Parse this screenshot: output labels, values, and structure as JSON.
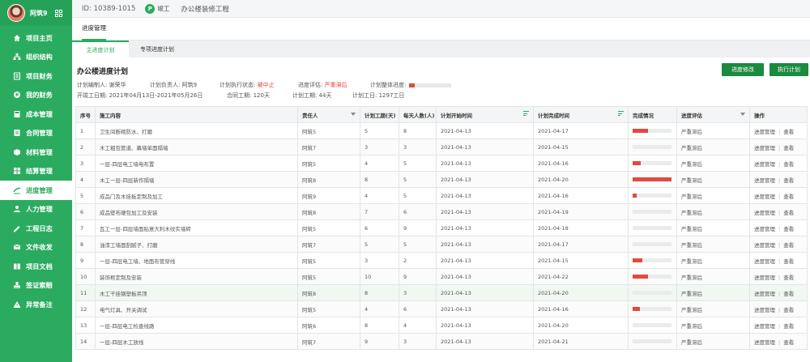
{
  "sidebar": {
    "user": "阿筑9",
    "items": [
      {
        "label": "项目主页",
        "icon": "home-icon"
      },
      {
        "label": "组织结构",
        "icon": "org-icon"
      },
      {
        "label": "项目财务",
        "icon": "finance-icon"
      },
      {
        "label": "我的财务",
        "icon": "wallet-icon"
      },
      {
        "label": "成本管理",
        "icon": "calc-icon"
      },
      {
        "label": "合同管理",
        "icon": "contract-icon"
      },
      {
        "label": "材料管理",
        "icon": "material-icon"
      },
      {
        "label": "结算管理",
        "icon": "grid-icon"
      },
      {
        "label": "进度管理",
        "icon": "progress-icon",
        "active": true
      },
      {
        "label": "人力管理",
        "icon": "person-icon"
      },
      {
        "label": "工程日志",
        "icon": "log-icon"
      },
      {
        "label": "文件收发",
        "icon": "mail-icon"
      },
      {
        "label": "项目文档",
        "icon": "book-icon"
      },
      {
        "label": "签证索赔",
        "icon": "stamp-icon"
      },
      {
        "label": "异常备注",
        "icon": "warning-icon"
      }
    ]
  },
  "header": {
    "id_text": "ID: 10389-1015",
    "badge": "P",
    "status": "竣工",
    "project": "办公楼装修工程"
  },
  "subnav": {
    "active": "进度管理"
  },
  "tabs": [
    "主进度计划",
    "专项进度计划"
  ],
  "panel": {
    "title": "办公楼进度计划",
    "btn_edit": "进度修改",
    "btn_run": "执行计划",
    "info1": {
      "maker": "计划编制人: 谢荣华",
      "owner": "计划负责人: 阿筑9",
      "exec_label": "计划执行状态: ",
      "exec_value": "被中止",
      "eval_label": "进度评估: ",
      "eval_value": "严重滞后",
      "overall_label": "计划整体进度:",
      "overall_progress": 0.12
    },
    "info2": {
      "dates": "开竣工日期: 2021年04月13日-2021年05月26日",
      "contract": "合同工期: 120天",
      "plan": "计划工期: 44天",
      "workdays": "计划工日: 1297工日"
    }
  },
  "table": {
    "headers": [
      "序号",
      "施工内容",
      "责任人",
      "计划工期(天)",
      "每天人数(人)",
      "计划开始时间",
      "计划完成时间",
      "完成情况",
      "进度评估",
      "操作"
    ],
    "op_manage": "进度管理",
    "op_sep": "|",
    "op_view": "查看",
    "rows": [
      {
        "no": "1",
        "content": "卫生间断砌防水、打磨",
        "person": "阿筑5",
        "days": "5",
        "people": "8",
        "start": "2021-04-13",
        "end": "2021-04-17",
        "progress": 0.4,
        "eval": "严重滞后"
      },
      {
        "no": "2",
        "content": "木工粗包管道、幕墙单面隔墙",
        "person": "阿筑7",
        "days": "3",
        "people": "3",
        "start": "2021-04-13",
        "end": "2021-04-15",
        "progress": 0,
        "eval": "严重滞后"
      },
      {
        "no": "3",
        "content": "一层-四层电工墙电布置",
        "person": "阿筑5",
        "days": "4",
        "people": "5",
        "start": "2021-04-13",
        "end": "2021-04-16",
        "progress": 0.2,
        "eval": "严重滞后"
      },
      {
        "no": "4",
        "content": "木工一层-四层新作隔墙",
        "person": "阿筑8",
        "days": "8",
        "people": "5",
        "start": "2021-04-13",
        "end": "2021-04-20",
        "progress": 1.0,
        "eval": "严重滞后"
      },
      {
        "no": "5",
        "content": "成品门及木挂板定制及加工",
        "person": "阿筑9",
        "days": "4",
        "people": "5",
        "start": "2021-04-13",
        "end": "2021-04-16",
        "progress": 0.1,
        "eval": "严重滞后"
      },
      {
        "no": "6",
        "content": "成品壁布硬包加工及安装",
        "person": "阿筑8",
        "days": "7",
        "people": "6",
        "start": "2021-04-13",
        "end": "2021-04-19",
        "progress": 0,
        "eval": "严重滞后"
      },
      {
        "no": "7",
        "content": "瓦工一层-四层墙面贴意大利木纹实墙砖",
        "person": "阿筑5",
        "days": "6",
        "people": "9",
        "start": "2021-04-13",
        "end": "2021-04-18",
        "progress": 0,
        "eval": "严重滞后"
      },
      {
        "no": "8",
        "content": "油漆工墙面刮腻子、打磨",
        "person": "阿筑7",
        "days": "5",
        "people": "5",
        "start": "2021-04-13",
        "end": "2021-04-17",
        "progress": 0,
        "eval": "严重滞后"
      },
      {
        "no": "9",
        "content": "一层-四层电工墙、地面布管穿线",
        "person": "阿筑5",
        "days": "3",
        "people": "2",
        "start": "2021-04-13",
        "end": "2021-04-15",
        "progress": 0.25,
        "eval": "严重滞后"
      },
      {
        "no": "10",
        "content": "装饰柜定制及安装",
        "person": "阿筑5",
        "days": "10",
        "people": "9",
        "start": "2021-04-13",
        "end": "2021-04-22",
        "progress": 0.4,
        "eval": "严重滞后"
      },
      {
        "no": "11",
        "content": "木工干挂钢塑板吊顶",
        "person": "阿筑8",
        "days": "8",
        "people": "3",
        "start": "2021-04-13",
        "end": "2021-04-20",
        "progress": 0,
        "eval": "严重滞后"
      },
      {
        "no": "12",
        "content": "电气灯具、开关调试",
        "person": "阿筑5",
        "days": "4",
        "people": "6",
        "start": "2021-04-13",
        "end": "2021-04-16",
        "progress": 0.18,
        "eval": "严重滞后"
      },
      {
        "no": "13",
        "content": "一层-四层电工检查线路",
        "person": "阿筑6",
        "days": "8",
        "people": "4",
        "start": "2021-04-13",
        "end": "2021-04-20",
        "progress": 0,
        "eval": "严重滞后"
      },
      {
        "no": "14",
        "content": "一层-四层木工放线",
        "person": "阿筑7",
        "days": "9",
        "people": "3",
        "start": "2021-04-13",
        "end": "2021-04-21",
        "progress": 0,
        "eval": "严重滞后"
      }
    ]
  },
  "colors": {
    "brand": "#2bab5f",
    "danger": "#e04a3f",
    "button": "#198a3f"
  }
}
